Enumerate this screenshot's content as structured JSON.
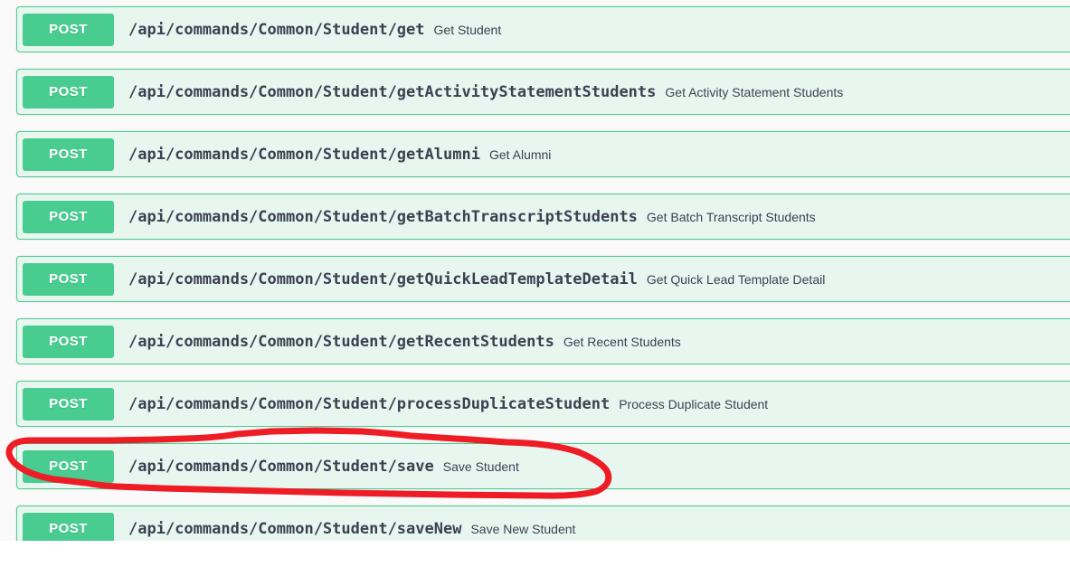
{
  "page": {
    "background_color": "#fafafa",
    "below_fold_color": "#ffffff"
  },
  "method_badge": {
    "label": "POST",
    "color": "#49cc90"
  },
  "colors": {
    "method_green": "#49cc90",
    "row_background": "#e8f6f0",
    "row_border": "#49cc90",
    "text_dark": "#3b4151",
    "annotation_red": "#ee1c24",
    "page_background": "#fafafa"
  },
  "operations": [
    {
      "method": "POST",
      "path": "/api/commands/Common/Student/get",
      "description": "Get Student"
    },
    {
      "method": "POST",
      "path": "/api/commands/Common/Student/getActivityStatementStudents",
      "description": "Get Activity Statement Students"
    },
    {
      "method": "POST",
      "path": "/api/commands/Common/Student/getAlumni",
      "description": "Get Alumni"
    },
    {
      "method": "POST",
      "path": "/api/commands/Common/Student/getBatchTranscriptStudents",
      "description": "Get Batch Transcript Students"
    },
    {
      "method": "POST",
      "path": "/api/commands/Common/Student/getQuickLeadTemplateDetail",
      "description": "Get Quick Lead Template Detail"
    },
    {
      "method": "POST",
      "path": "/api/commands/Common/Student/getRecentStudents",
      "description": "Get Recent Students"
    },
    {
      "method": "POST",
      "path": "/api/commands/Common/Student/processDuplicateStudent",
      "description": "Process Duplicate Student"
    },
    {
      "method": "POST",
      "path": "/api/commands/Common/Student/save",
      "description": "Save Student"
    },
    {
      "method": "POST",
      "path": "/api/commands/Common/Student/saveNew",
      "description": "Save New Student"
    }
  ],
  "annotation": {
    "type": "freehand-ellipse",
    "color": "#ee1c24",
    "stroke_width": 7,
    "highlights_operation_index": 7,
    "highlights_path": "/api/commands/Common/Student/save"
  }
}
